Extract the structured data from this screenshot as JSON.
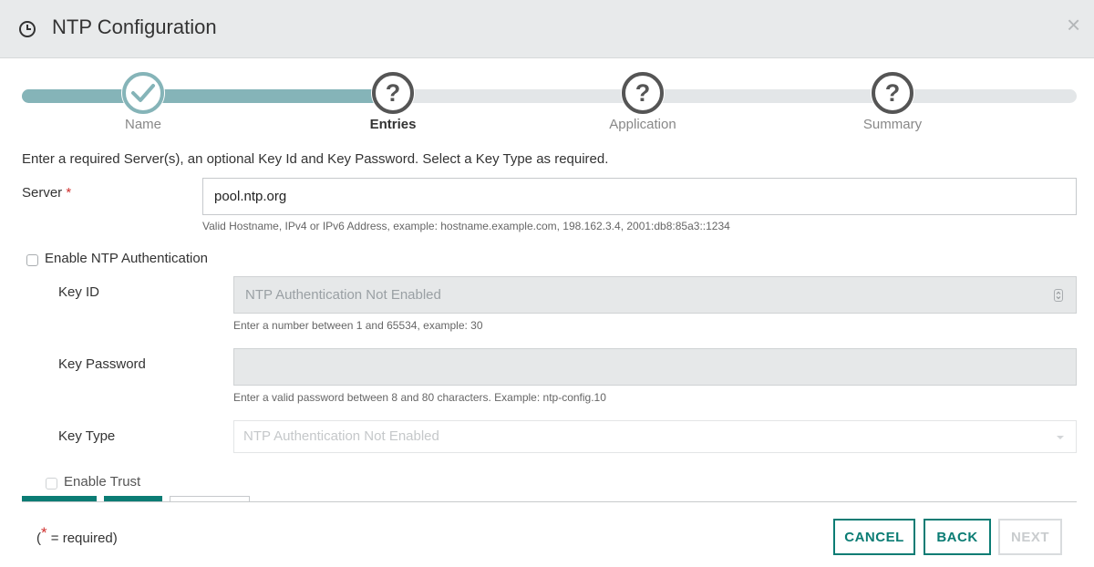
{
  "dialog": {
    "title": "NTP Configuration",
    "close_glyph": "×",
    "icon": "clock-icon"
  },
  "wizard": {
    "progress_fraction": 0.35,
    "steps": [
      {
        "label": "Name",
        "state": "complete"
      },
      {
        "label": "Entries",
        "state": "active"
      },
      {
        "label": "Application",
        "state": "pending"
      },
      {
        "label": "Summary",
        "state": "pending"
      }
    ]
  },
  "instructions": "Enter a required Server(s), an optional Key Id and Key Password. Select a Key Type as required.",
  "server": {
    "label": "Server",
    "required_mark": "*",
    "value": "pool.ntp.org",
    "hint": "Valid Hostname, IPv4 or IPv6 Address, example: hostname.example.com, 198.162.3.4, 2001:db8:85a3::1234"
  },
  "auth": {
    "checkbox_label": "Enable NTP Authentication",
    "checked": false,
    "key_id": {
      "label": "Key ID",
      "placeholder": "NTP Authentication Not Enabled",
      "hint": "Enter a number between 1 and 65534, example: 30"
    },
    "key_password": {
      "label": "Key Password",
      "value": "",
      "hint": "Enter a valid password between 8 and 80 characters. Example: ntp-config.10"
    },
    "key_type": {
      "label": "Key Type",
      "selected": "NTP Authentication Not Enabled"
    },
    "trust_label": "Enable Trust"
  },
  "footer": {
    "required_star": "*",
    "required_text": " = required)",
    "required_open": "(",
    "cancel": "CANCEL",
    "back": "BACK",
    "next": "NEXT"
  },
  "colors": {
    "accent": "#0b7c74",
    "progress": "#85b4b8",
    "required": "#d0302e"
  }
}
